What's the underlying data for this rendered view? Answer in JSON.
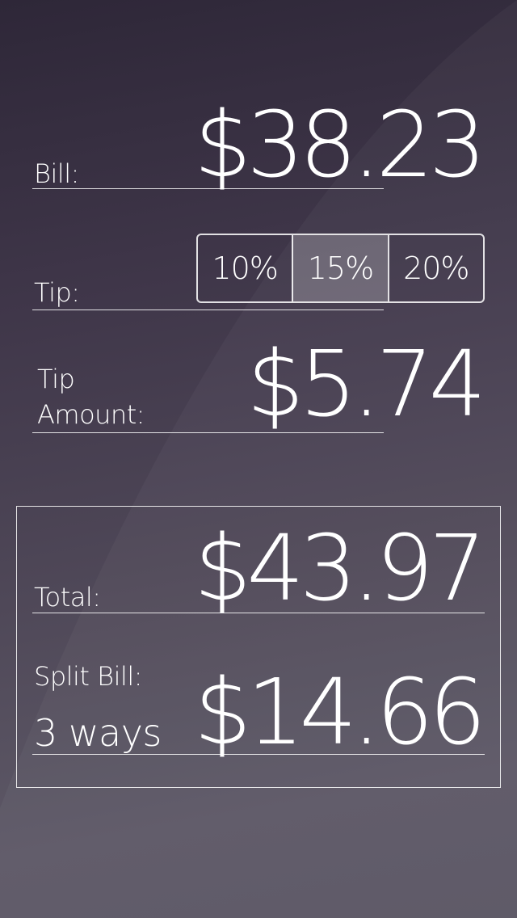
{
  "bill": {
    "label": "Bill:",
    "amount": "$38.23"
  },
  "tip": {
    "label": "Tip:",
    "options": [
      {
        "label": "10%",
        "selected": false
      },
      {
        "label": "15%",
        "selected": true
      },
      {
        "label": "20%",
        "selected": false
      }
    ]
  },
  "tip_amount": {
    "label_line1": "Tip",
    "label_line2": "Amount:",
    "amount": "$5.74"
  },
  "total": {
    "label": "Total:",
    "amount": "$43.97"
  },
  "split": {
    "label": "Split Bill:",
    "ways": "3 ways",
    "amount": "$14.66"
  }
}
